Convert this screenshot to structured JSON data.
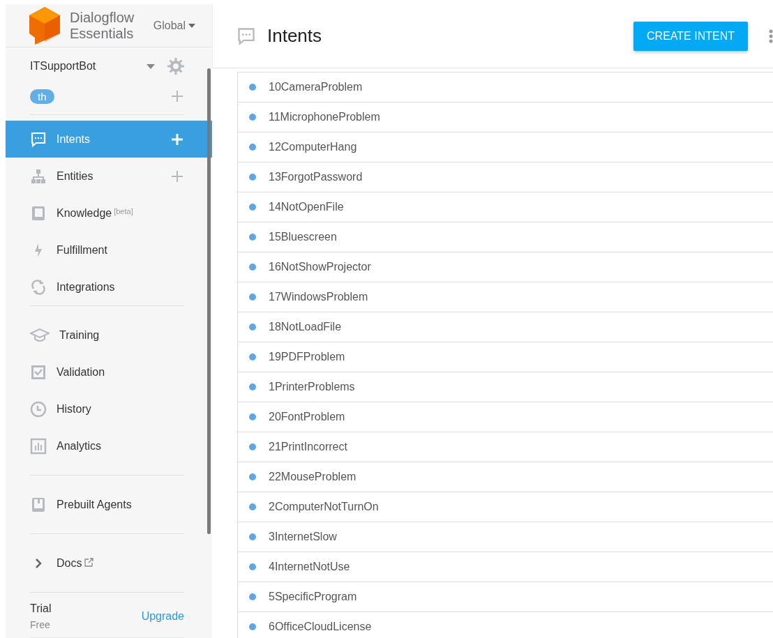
{
  "brand": {
    "line1": "Dialogflow",
    "line2": "Essentials",
    "region": "Global"
  },
  "agent": {
    "name": "ITSupportBot",
    "language": "th"
  },
  "nav_sections": [
    [
      {
        "label": "Intents",
        "selected": true,
        "add": true
      },
      {
        "label": "Entities",
        "selected": false,
        "add": true
      },
      {
        "label": "Knowledge",
        "sup": "[beta]",
        "selected": false,
        "add": false
      },
      {
        "label": "Fulfillment",
        "selected": false,
        "add": false
      },
      {
        "label": "Integrations",
        "selected": false,
        "add": false
      }
    ],
    [
      {
        "label": "Training",
        "selected": false,
        "add": false
      },
      {
        "label": "Validation",
        "selected": false,
        "add": false
      },
      {
        "label": "History",
        "selected": false,
        "add": false
      },
      {
        "label": "Analytics",
        "selected": false,
        "add": false
      }
    ],
    [
      {
        "label": "Prebuilt Agents",
        "selected": false,
        "add": false
      }
    ],
    [
      {
        "label": "Docs",
        "selected": false,
        "add": false,
        "external": true
      }
    ]
  ],
  "plan": {
    "name": "Trial",
    "tier": "Free",
    "action": "Upgrade"
  },
  "page": {
    "title": "Intents",
    "button": "CREATE INTENT"
  },
  "intents": [
    "10CameraProblem",
    "11MicrophoneProblem",
    "12ComputerHang",
    "13ForgotPassword",
    "14NotOpenFile",
    "15Bluescreen",
    "16NotShowProjector",
    "17WindowsProblem",
    "18NotLoadFile",
    "19PDFProblem",
    "1PrinterProblems",
    "20FontProblem",
    "21PrintIncorrect",
    "22MouseProblem",
    "2ComputerNotTurnOn",
    "3InternetSlow",
    "4InternetNotUse",
    "5SpecificProgram",
    "6OfficeCloudLicense"
  ]
}
